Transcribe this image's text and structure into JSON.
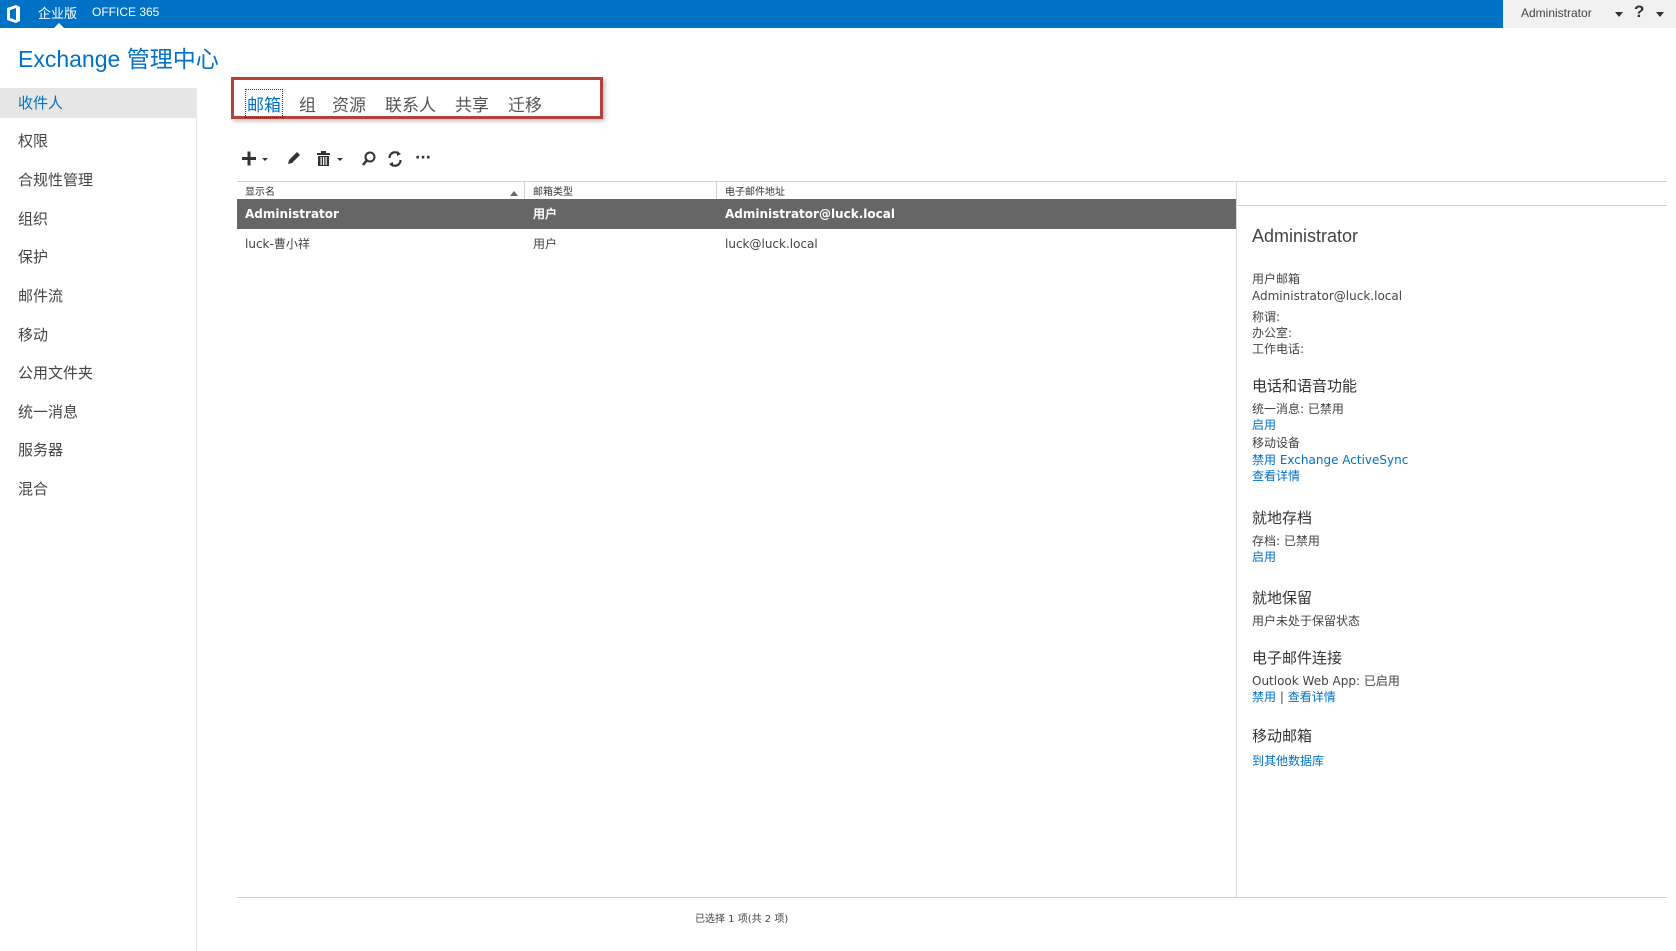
{
  "topbar": {
    "edition": "企业版",
    "suite": "OFFICE 365",
    "user": "Administrator",
    "help": "?"
  },
  "app_title": "Exchange 管理中心",
  "nav": {
    "items": [
      {
        "label": "收件人",
        "active": true
      },
      {
        "label": "权限"
      },
      {
        "label": "合规性管理"
      },
      {
        "label": "组织"
      },
      {
        "label": "保护"
      },
      {
        "label": "邮件流"
      },
      {
        "label": "移动"
      },
      {
        "label": "公用文件夹"
      },
      {
        "label": "统一消息"
      },
      {
        "label": "服务器"
      },
      {
        "label": "混合"
      }
    ]
  },
  "tabs": [
    {
      "label": "邮箱",
      "active": true
    },
    {
      "label": "组"
    },
    {
      "label": "资源"
    },
    {
      "label": "联系人"
    },
    {
      "label": "共享"
    },
    {
      "label": "迁移"
    }
  ],
  "toolbar": {
    "icons": [
      "add-icon",
      "edit-icon",
      "delete-icon",
      "search-icon",
      "refresh-icon",
      "more-icon"
    ],
    "more_label": "···"
  },
  "table": {
    "columns": [
      "显示名",
      "邮箱类型",
      "电子邮件地址"
    ],
    "rows": [
      {
        "name": "Administrator",
        "type": "用户",
        "email": "Administrator@luck.local",
        "selected": true
      },
      {
        "name": "luck-曹小祥",
        "type": "用户",
        "email": "luck@luck.local"
      }
    ]
  },
  "details": {
    "title": "Administrator",
    "user_mailbox_label": "用户邮箱",
    "email": "Administrator@luck.local",
    "title_field": "称谓:",
    "office_field": "办公室:",
    "work_phone_field": "工作电话:",
    "phone_voice": {
      "header": "电话和语音功能",
      "um_status": "统一消息: 已禁用",
      "um_enable": "启用",
      "mobile_devices": "移动设备",
      "disable_eas": "禁用 Exchange ActiveSync",
      "view_details": "查看详情"
    },
    "archive": {
      "header": "就地存档",
      "status": "存档: 已禁用",
      "enable": "启用"
    },
    "hold": {
      "header": "就地保留",
      "status": "用户未处于保留状态"
    },
    "email_connectivity": {
      "header": "电子邮件连接",
      "owa_status": "Outlook Web App: 已启用",
      "disable": "禁用",
      "separator": " | ",
      "view_details": "查看详情"
    },
    "move_mailbox": {
      "header": "移动邮箱",
      "to_other_db": "到其他数据库"
    }
  },
  "status_bar": "已选择 1 项(共 2 项)",
  "colors": {
    "brand": "#0072c6",
    "selected_row": "#666666",
    "highlight_box": "#b3423a"
  }
}
